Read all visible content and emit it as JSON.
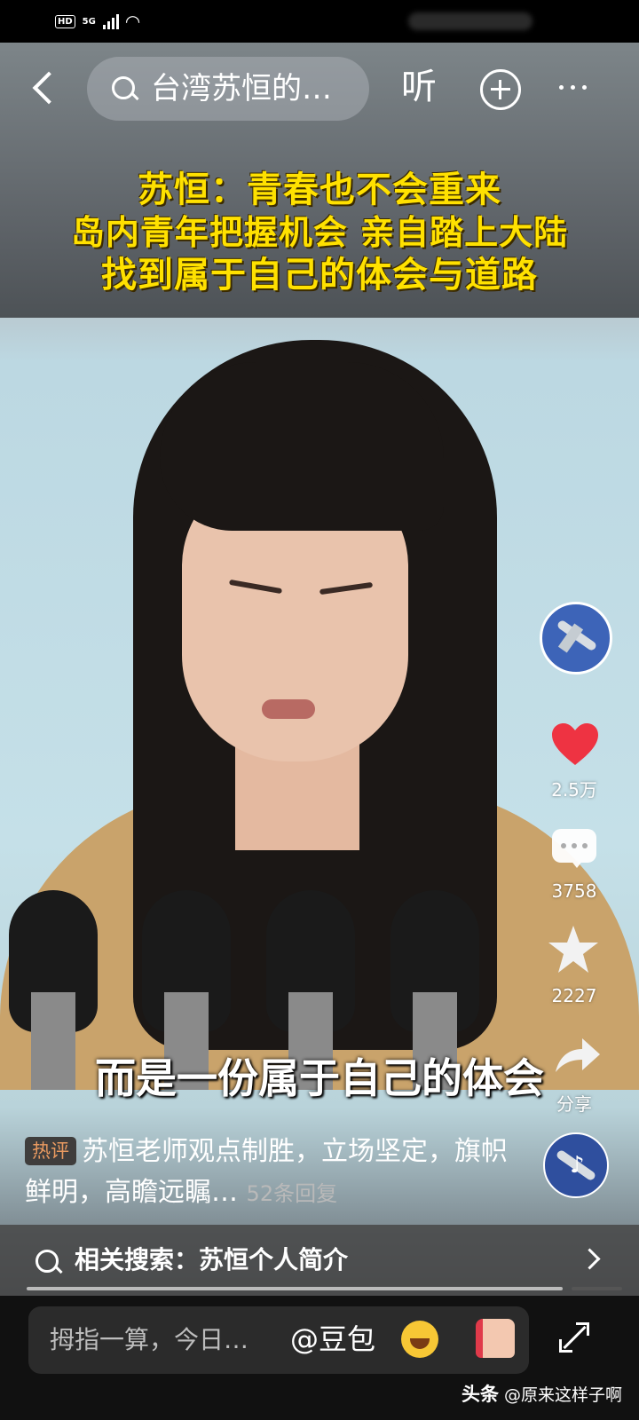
{
  "status_bar": {
    "hd": "HD",
    "network": "5G"
  },
  "nav": {
    "search_query": "台湾苏恒的…",
    "listen_label": "听"
  },
  "headline": {
    "lines": [
      "苏恒：青春也不会重来",
      "岛内青年把握机会 亲自踏上大陆",
      "找到属于自己的体会与道路"
    ]
  },
  "subtitle": "而是一份属于自己的体会",
  "actions": {
    "like_count": "2.5万",
    "comment_count": "3758",
    "favorite_count": "2227",
    "share_label": "分享"
  },
  "hot_comment": {
    "badge": "热评",
    "text": "苏恒老师观点制胜，立场坚定，旗帜鲜明，高瞻远瞩…",
    "replies": "52条回复"
  },
  "related_search": {
    "label": "相关搜索：苏恒个人简介"
  },
  "bottom": {
    "input_placeholder": "拇指一算，今日…",
    "mention": "@豆包"
  },
  "watermark": {
    "brand": "头条",
    "account": "@原来这样子啊"
  },
  "colors": {
    "headline": "#ffe100",
    "heart": "#ee3342",
    "hot_badge_text": "#e99a60"
  },
  "progress": {
    "fraction": 0.9
  }
}
